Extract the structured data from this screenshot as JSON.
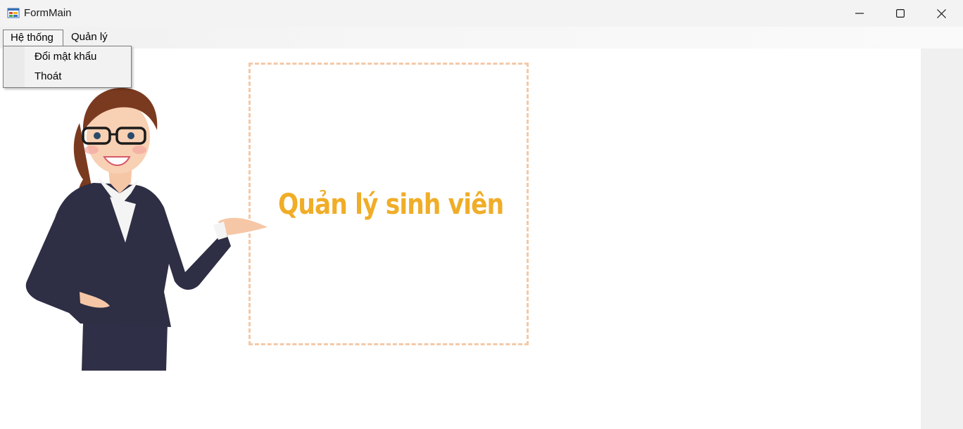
{
  "window": {
    "title": "FormMain",
    "icon": "app-form-icon",
    "controls": [
      "minimize-icon",
      "maximize-icon",
      "close-icon"
    ]
  },
  "menubar": {
    "items": [
      {
        "label": "Hệ thống"
      },
      {
        "label": "Quản lý"
      }
    ]
  },
  "dropdown": {
    "items": [
      {
        "label": "Đổi mật khẩu"
      },
      {
        "label": "Thoát"
      }
    ]
  },
  "content": {
    "headline": "Quản lý sinh viên",
    "illustration": "presenter-woman-illustration"
  },
  "colors": {
    "headline": "#f0ad28",
    "frame_border": "#f4c9a8",
    "suit": "#2e2e45",
    "client_bg": "#ffffff"
  }
}
